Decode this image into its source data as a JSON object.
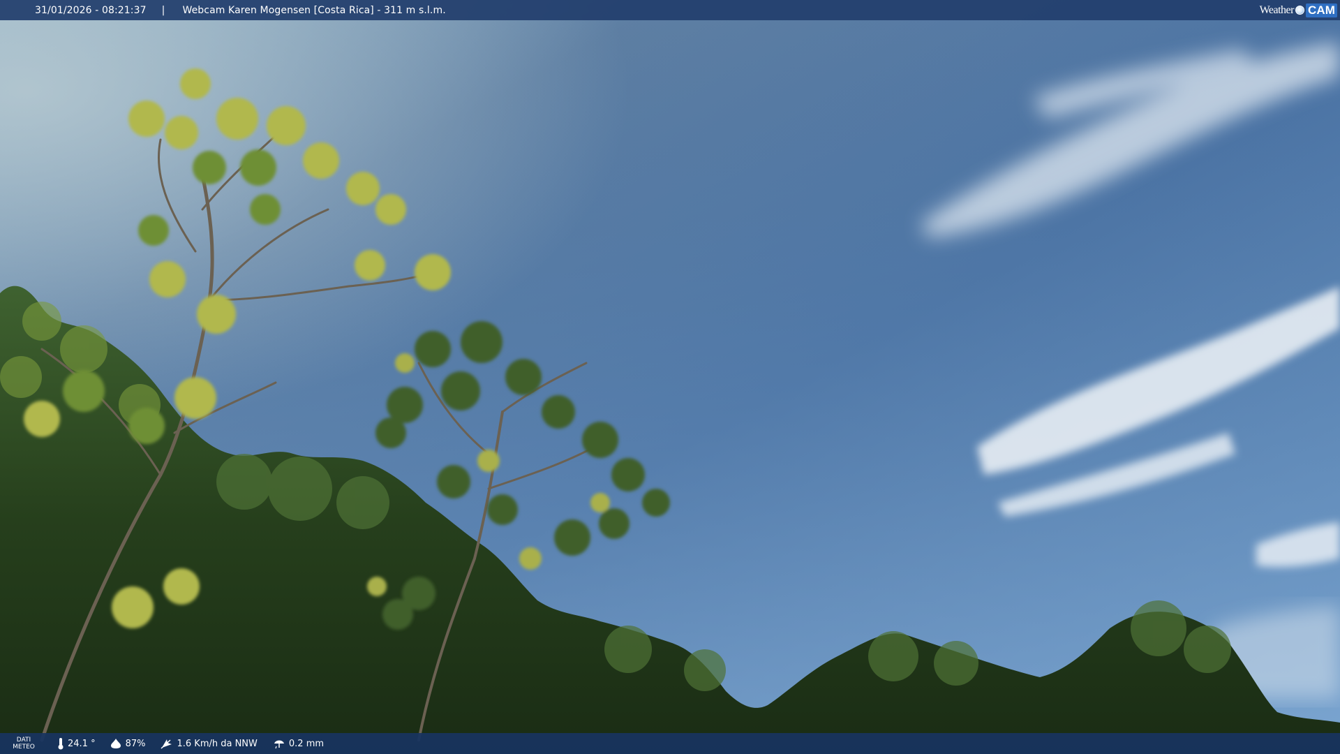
{
  "header": {
    "timestamp": "31/01/2026 - 08:21:37",
    "separator": "|",
    "title": "Webcam Karen Mogensen [Costa Rica] - 311 m s.l.m.",
    "brand_weather": "Weather",
    "brand_cam": "CAM"
  },
  "footer": {
    "dati_line1": "DATI",
    "dati_line2": "METEO",
    "temperature": "24.1 °",
    "humidity": "87%",
    "wind": "1.6 Km/h da NNW",
    "rain": "0.2 mm"
  },
  "icons": {
    "temperature": "thermometer-icon",
    "humidity": "droplet-icon",
    "wind": "wind-icon",
    "rain": "rain-icon"
  },
  "colors": {
    "bar": "#223e6c",
    "sky_top": "#3d6496",
    "sky_bottom": "#6a95c4",
    "foliage": "#2c4a1c"
  }
}
